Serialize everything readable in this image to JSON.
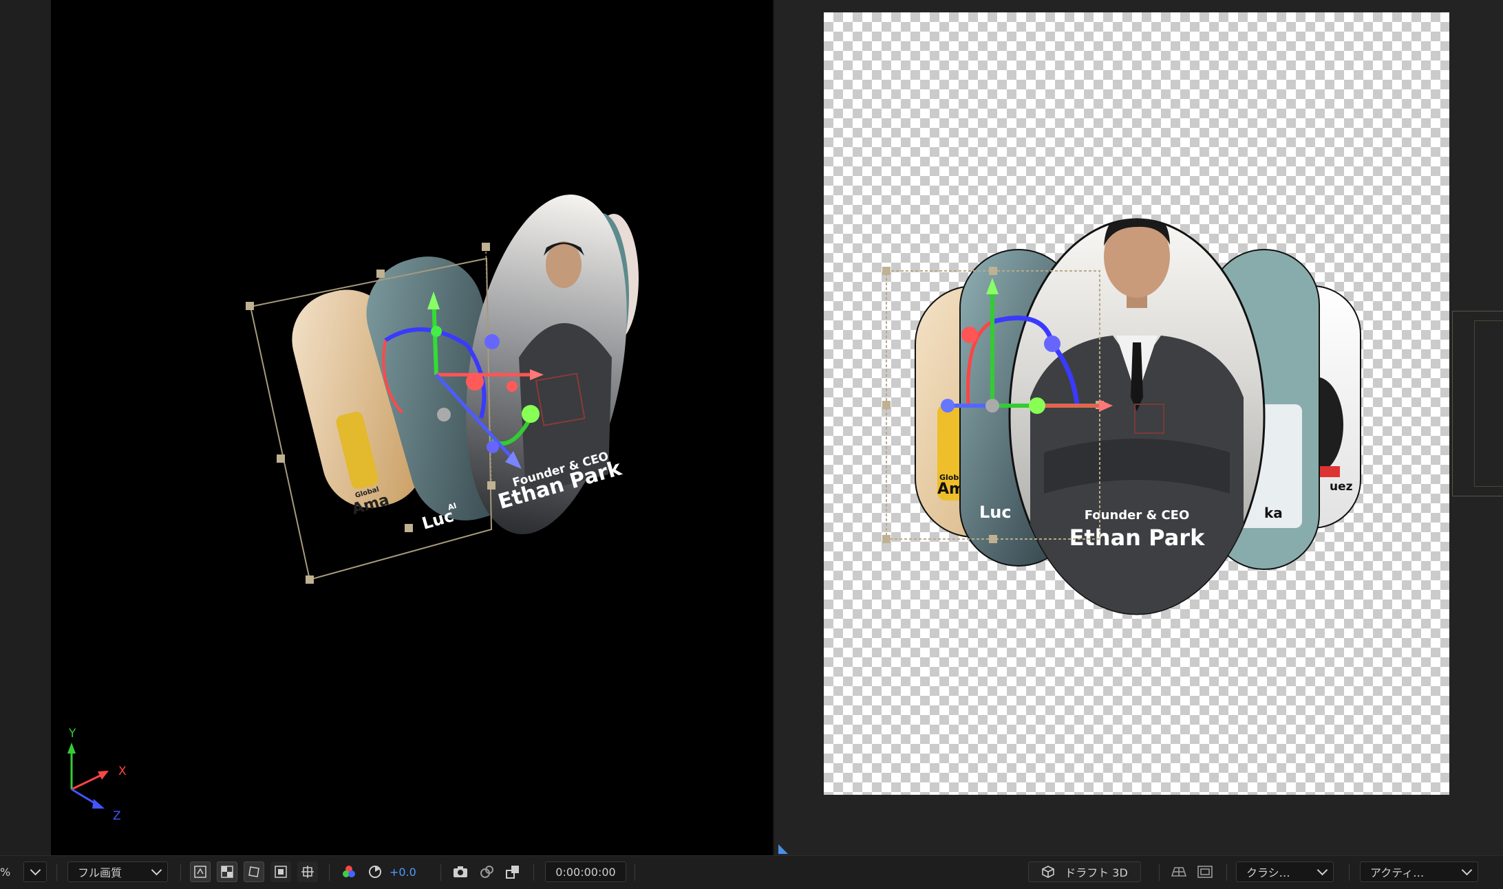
{
  "toolbar": {
    "zoom_suffix": "%",
    "quality_label": "フル画質",
    "exposure_value": "+0.0",
    "timecode": "0:00:00:00",
    "renderer_label": "ドラフト 3D",
    "view_label": "クラシ…",
    "camera_label": "アクティ…"
  },
  "axis_gizmo": {
    "x": "X",
    "y": "Y",
    "z": "Z"
  },
  "cards": {
    "main": {
      "title": "Founder & CEO",
      "name": "Ethan Park"
    },
    "left1": {
      "title": "AI",
      "name": "Luc"
    },
    "left2": {
      "title": "Global",
      "name": "Ama"
    },
    "right1": {
      "name": "ka"
    },
    "right2": {
      "name": "uez"
    }
  },
  "colors": {
    "canvas_bg": "#000000",
    "accent_blue": "#4f9bff",
    "gizmo_x": "#ff5555",
    "gizmo_y": "#55cc55",
    "gizmo_z": "#5566ff"
  }
}
